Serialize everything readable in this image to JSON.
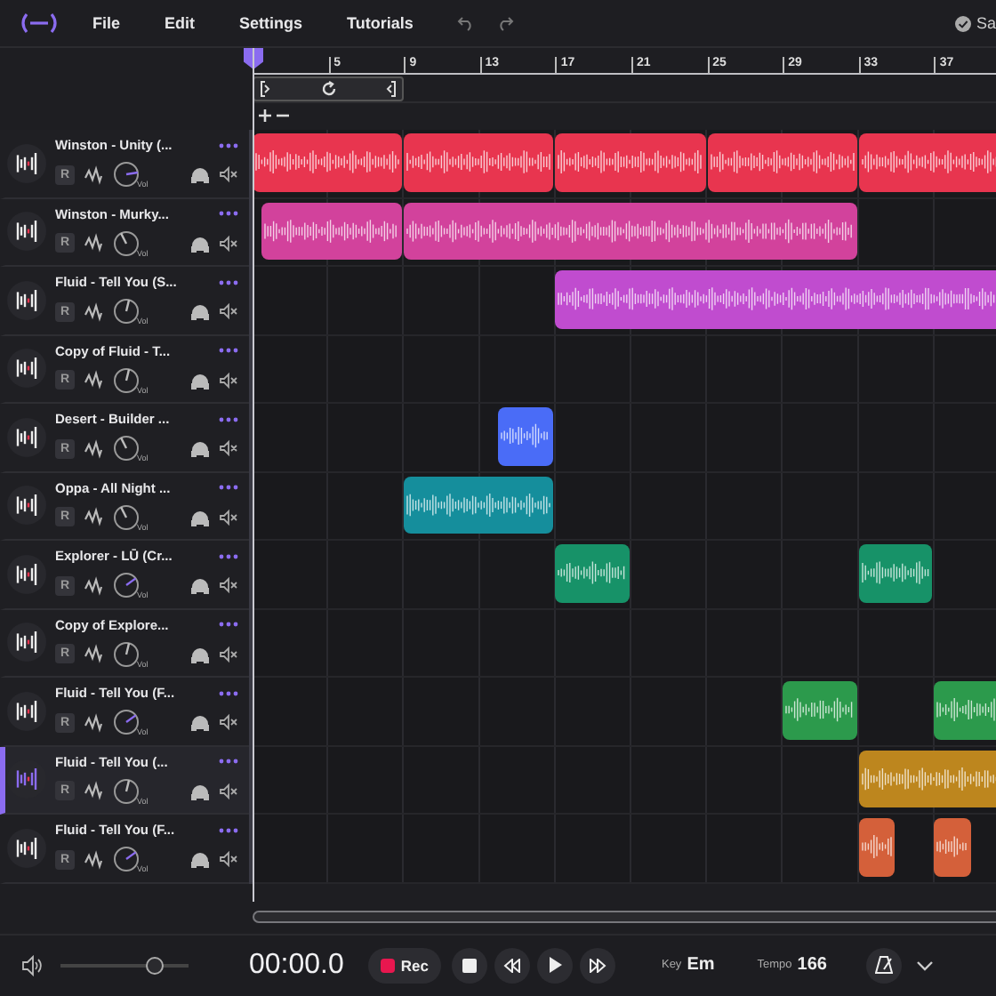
{
  "menu": {
    "items": [
      "File",
      "Edit",
      "Settings",
      "Tutorials"
    ],
    "status": "Sa"
  },
  "ruler": [
    "5",
    "9",
    "13",
    "17",
    "21",
    "25",
    "29",
    "33",
    "37"
  ],
  "tracks": [
    {
      "name": "Winston - Unity (...",
      "selected": false,
      "record_label": "R",
      "volume_label": "Vol",
      "clips": [
        {
          "color": "#e8354f"
        },
        {
          "color": "#e8354f"
        },
        {
          "color": "#e8354f"
        },
        {
          "color": "#e8354f"
        },
        {
          "color": "#e8354f"
        }
      ]
    },
    {
      "name": "Winston - Murky...",
      "selected": false,
      "record_label": "R",
      "volume_label": "Vol",
      "clips": [
        {
          "color": "#d2429c"
        },
        {
          "color": "#d2429c"
        }
      ]
    },
    {
      "name": "Fluid - Tell You (S...",
      "selected": false,
      "record_label": "R",
      "volume_label": "Vol",
      "clips": [
        {
          "color": "#c04ccf"
        }
      ]
    },
    {
      "name": "Copy of Fluid - T...",
      "selected": false,
      "record_label": "R",
      "volume_label": "Vol"
    },
    {
      "name": "Desert - Builder ...",
      "selected": false,
      "record_label": "R",
      "volume_label": "Vol",
      "clips": [
        {
          "color": "#4a6cf7"
        }
      ]
    },
    {
      "name": "Oppa - All Night ...",
      "selected": false,
      "record_label": "R",
      "volume_label": "Vol",
      "clips": [
        {
          "color": "#158e9c"
        }
      ]
    },
    {
      "name": "Explorer - LŪ (Cr...",
      "selected": false,
      "record_label": "R",
      "volume_label": "Vol",
      "clips": [
        {
          "color": "#179268"
        },
        {
          "color": "#179268"
        }
      ]
    },
    {
      "name": "Copy of Explore...",
      "selected": false,
      "record_label": "R",
      "volume_label": "Vol"
    },
    {
      "name": "Fluid - Tell You (F...",
      "selected": false,
      "record_label": "R",
      "volume_label": "Vol",
      "clips": [
        {
          "color": "#2c9a4c"
        },
        {
          "color": "#2c9a4c"
        }
      ]
    },
    {
      "name": "Fluid - Tell You (...",
      "selected": true,
      "record_label": "R",
      "volume_label": "Vol",
      "clips": [
        {
          "color": "#bd861e"
        }
      ]
    },
    {
      "name": "Fluid - Tell You (F...",
      "selected": false,
      "record_label": "R",
      "volume_label": "Vol",
      "clips": [
        {
          "color": "#d4603a"
        },
        {
          "color": "#d4603a"
        }
      ]
    }
  ],
  "transport": {
    "master_volume": {
      "level": 0.73
    },
    "time": "00:00.0",
    "rec": "Rec",
    "key_label": "Key",
    "key": "Em",
    "tempo_label": "Tempo",
    "tempo": "166"
  }
}
